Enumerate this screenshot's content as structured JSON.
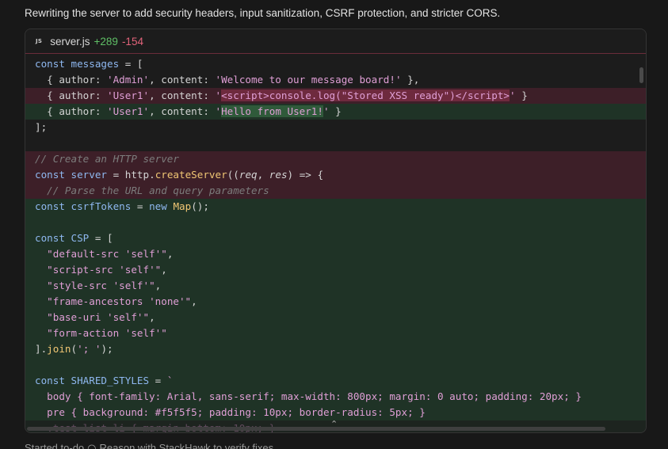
{
  "intro_text": "Rewriting the server to add security headers, input sanitization, CSRF protection, and stricter CORS.",
  "file": {
    "badge": "JS",
    "name": "server.js",
    "added": "+289",
    "removed": "-154"
  },
  "footer": {
    "status": "Started to-do",
    "task": "Reason with StackHawk to verify fixes"
  },
  "colors": {
    "deleted_bg": "#3d1f28",
    "inserted_bg": "#1f3326",
    "added_text": "#5fbf66",
    "removed_text": "#e2637a"
  }
}
